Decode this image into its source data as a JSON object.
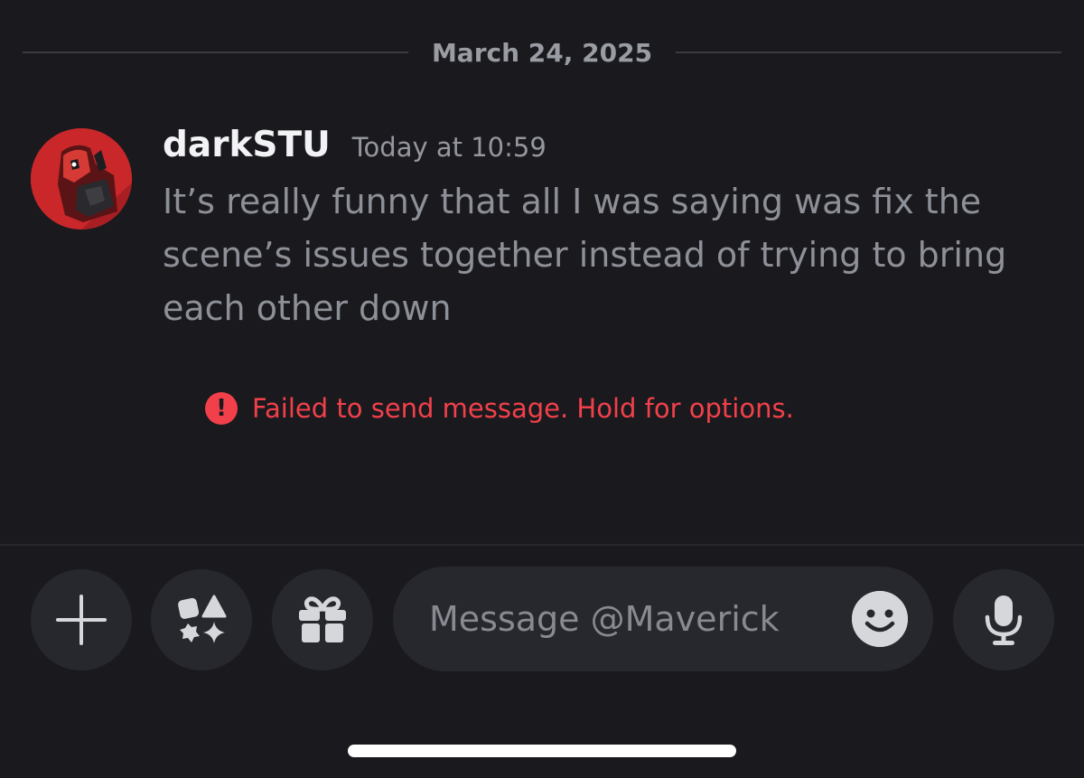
{
  "date_divider": "March 24, 2025",
  "message": {
    "username": "darkSTU",
    "timestamp": "Today at 10:59",
    "text": "It’s really funny that all I was saying was fix the scene’s issues together instead of trying to bring each other down",
    "error": "Failed to send message. Hold for options."
  },
  "composer": {
    "placeholder": "Message @Maverick",
    "buttons": [
      "plus-icon",
      "apps-icon",
      "gift-icon",
      "emoji-icon",
      "microphone-icon"
    ]
  },
  "colors": {
    "background": "#1a1a1e",
    "button_bg": "#27282d",
    "error": "#f2404a",
    "avatar_red": "#c9272a"
  }
}
